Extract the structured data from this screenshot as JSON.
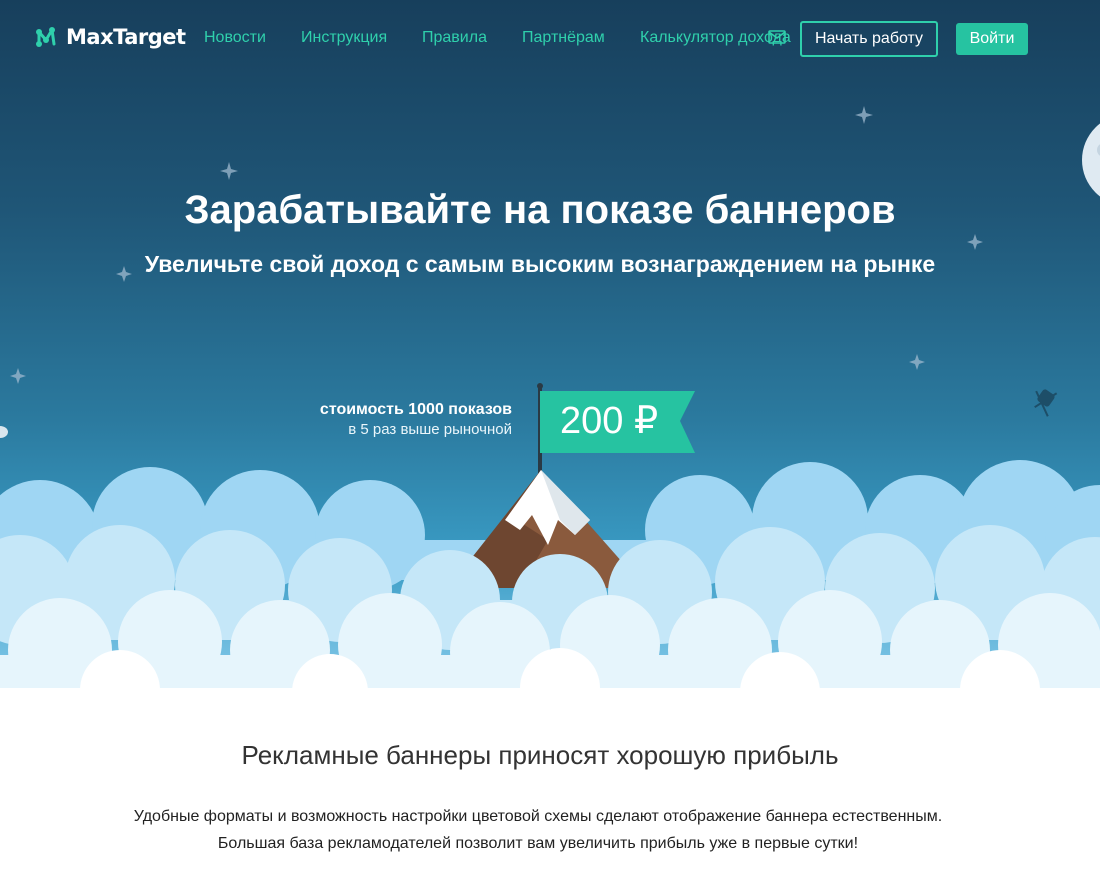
{
  "header": {
    "logo_text": "MaxTarget",
    "nav": [
      {
        "label": "Новости"
      },
      {
        "label": "Инструкция"
      },
      {
        "label": "Правила"
      },
      {
        "label": "Партнёрам"
      },
      {
        "label": "Калькулятор дохода"
      }
    ],
    "start_button": "Начать работу",
    "login_button": "Войти",
    "mail_icon": "envelope-icon"
  },
  "hero": {
    "title": "Зарабатывайте на показе баннеров",
    "subtitle": "Увеличьте свой доход с самым высоким вознаграждением на рынке",
    "cost_line1": "стоимость 1000 показов",
    "cost_line2": "в 5 раз выше рыночной",
    "price": "200 ₽"
  },
  "content": {
    "title": "Рекламные баннеры приносят хорошую прибыль",
    "paragraph1": "Удобные форматы и возможность настройки цветовой схемы сделают отображение баннера естественным.",
    "paragraph2": "Большая база рекламодателей позволит вам увеличить прибыль уже в первые сутки!"
  },
  "colors": {
    "accent": "#26c3a1",
    "nav_link": "#2fd0ac",
    "sky_top": "#173f5c",
    "sky_bottom": "#3a9cc5",
    "text_dark": "#333333"
  }
}
